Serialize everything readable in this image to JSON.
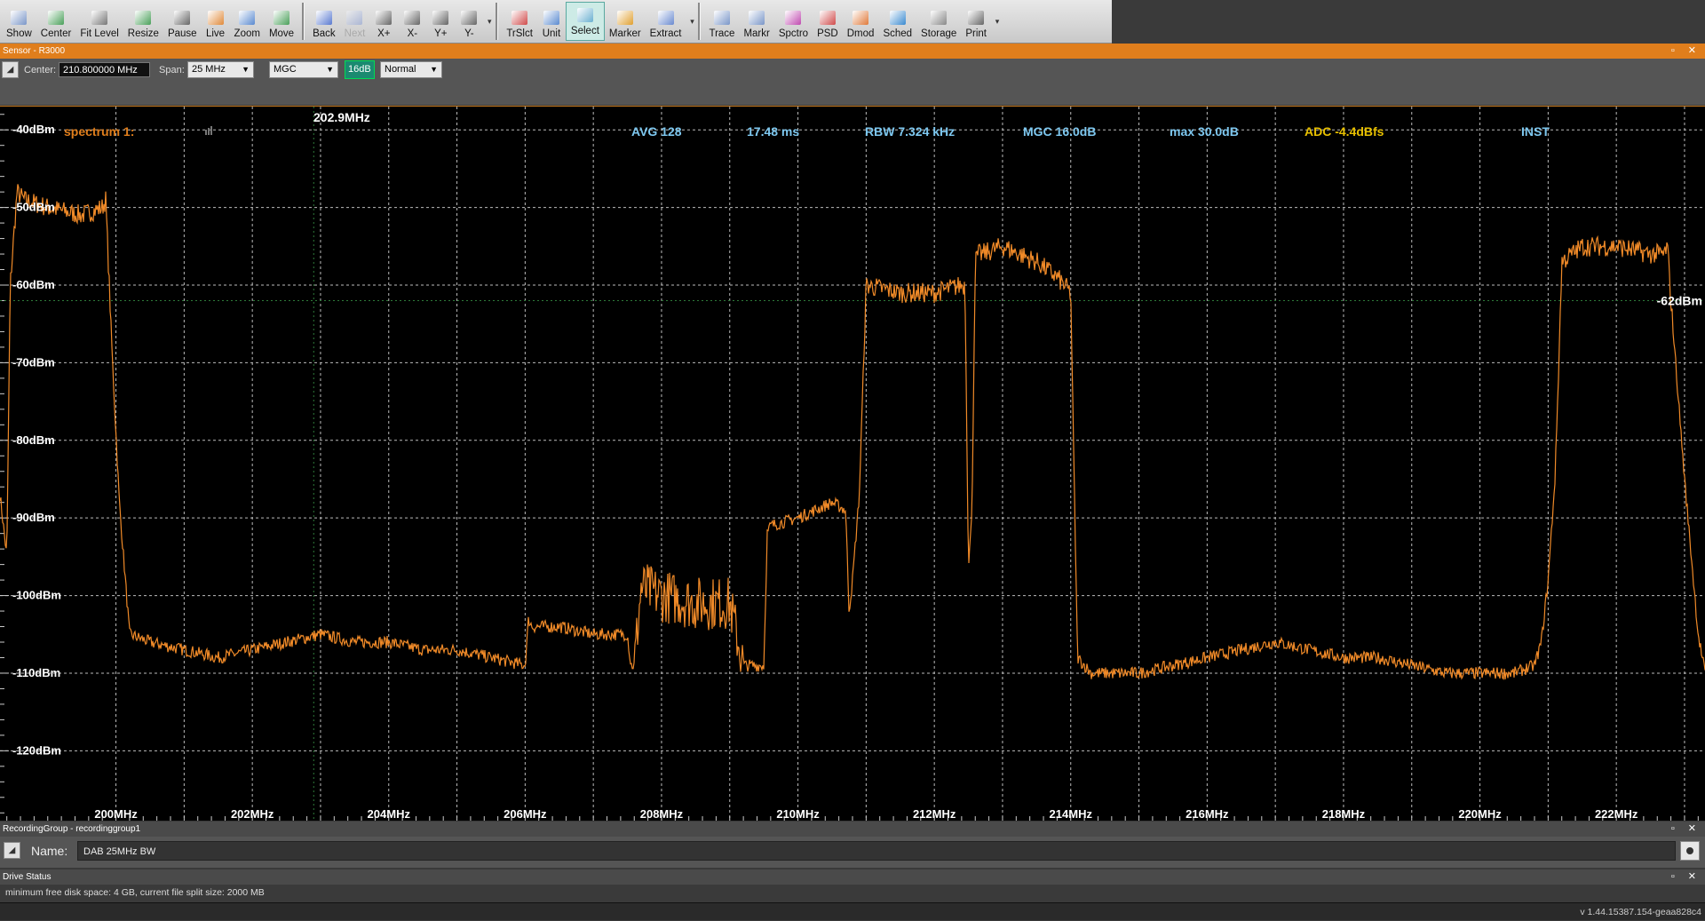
{
  "toolbar": {
    "groups": [
      [
        {
          "label": "Show",
          "icon": "show-icon",
          "color": "#7a96c8"
        },
        {
          "label": "Center",
          "icon": "center-icon",
          "color": "#4aa05a"
        },
        {
          "label": "Fit Level",
          "icon": "fit-level-icon",
          "color": "#777777"
        },
        {
          "label": "Resize",
          "icon": "resize-icon",
          "color": "#4aa05a"
        },
        {
          "label": "Pause",
          "icon": "pause-icon",
          "color": "#666666"
        },
        {
          "label": "Live",
          "icon": "live-icon",
          "color": "#e08a3a"
        },
        {
          "label": "Zoom",
          "icon": "zoom-icon",
          "color": "#5a8ad0"
        },
        {
          "label": "Move",
          "icon": "move-icon",
          "color": "#4aa05a"
        }
      ],
      [
        {
          "label": "Back",
          "icon": "back-icon",
          "color": "#5a7ad0"
        },
        {
          "label": "Next",
          "icon": "next-icon",
          "color": "#5a7ad0",
          "disabled": true
        },
        {
          "label": "X+",
          "icon": "x-plus-icon",
          "color": "#666666"
        },
        {
          "label": "X-",
          "icon": "x-minus-icon",
          "color": "#666666"
        },
        {
          "label": "Y+",
          "icon": "y-plus-icon",
          "color": "#666666"
        },
        {
          "label": "Y-",
          "icon": "y-minus-icon",
          "color": "#666666"
        }
      ],
      [
        {
          "label": "TrSlct",
          "icon": "trace-select-icon",
          "color": "#d04a4a"
        },
        {
          "label": "Unit",
          "icon": "unit-icon",
          "color": "#5a8ad0"
        },
        {
          "label": "Select",
          "icon": "select-icon",
          "color": "#6ab0d0",
          "active": true
        },
        {
          "label": "Marker",
          "icon": "marker-icon",
          "color": "#e0a030"
        },
        {
          "label": "Extract",
          "icon": "extract-icon",
          "color": "#6a8ad0"
        }
      ],
      [
        {
          "label": "Trace",
          "icon": "trace-icon",
          "color": "#7a96c8"
        },
        {
          "label": "Markr",
          "icon": "markr-icon",
          "color": "#7a96c8"
        },
        {
          "label": "Spctro",
          "icon": "spectro-icon",
          "color": "#c04ab0"
        },
        {
          "label": "PSD",
          "icon": "psd-icon",
          "color": "#d04a4a"
        },
        {
          "label": "Dmod",
          "icon": "dmod-icon",
          "color": "#e07a3a"
        },
        {
          "label": "Sched",
          "icon": "sched-icon",
          "color": "#3a8ad0"
        },
        {
          "label": "Storage",
          "icon": "storage-icon",
          "color": "#888888"
        },
        {
          "label": "Print",
          "icon": "print-icon",
          "color": "#666666"
        }
      ]
    ]
  },
  "sensor": {
    "title": "Sensor - R3000",
    "center_label": "Center:",
    "center_value": "210.800000  MHz",
    "span_label": "Span:",
    "span_value": "25 MHz",
    "gain_mode": "MGC",
    "gain_value": "16dB",
    "mode": "Normal"
  },
  "spectrum_info": {
    "label": "spectrum 1:",
    "avg": "AVG 128",
    "time": "17.48 ms",
    "rbw": "RBW 7.324 kHz",
    "mgc": "MGC 16.0dB",
    "max": "max 30.0dB",
    "adc": "ADC -4.4dBfs",
    "inst": "INST",
    "cursor_freq": "202.9MHz",
    "ref_level": "-62dBm"
  },
  "colors": {
    "trace": "#f08a28",
    "info_blue": "#7ec8f0",
    "info_yellow": "#e8c000",
    "accent_orange": "#e07e1c"
  },
  "chart_data": {
    "type": "line",
    "xlabel": "",
    "ylabel": "",
    "xlim": [
      198.3,
      223.3
    ],
    "ylim": [
      -129,
      -37
    ],
    "x_ticks": [
      "200MHz",
      "202MHz",
      "204MHz",
      "206MHz",
      "208MHz",
      "210MHz",
      "212MHz",
      "214MHz",
      "216MHz",
      "218MHz",
      "220MHz",
      "222MHz"
    ],
    "x_tick_values": [
      200,
      202,
      204,
      206,
      208,
      210,
      212,
      214,
      216,
      218,
      220,
      222
    ],
    "y_ticks": [
      "-40dBm",
      "-50dBm",
      "-60dBm",
      "-70dBm",
      "-80dBm",
      "-90dBm",
      "-100dBm",
      "-110dBm",
      "-120dBm"
    ],
    "y_tick_values": [
      -40,
      -50,
      -60,
      -70,
      -80,
      -90,
      -100,
      -110,
      -120
    ],
    "grid": true,
    "series": [
      {
        "x": [
          198.3,
          198.4,
          198.45,
          198.55,
          198.65,
          199.0,
          199.5,
          199.8,
          199.85,
          199.95,
          200.05,
          200.2,
          200.5,
          201.0,
          201.5,
          202.0,
          202.5,
          203.0,
          203.5,
          204.0,
          204.5,
          205.0,
          205.5,
          206.0,
          206.05,
          206.1,
          206.5,
          207.0,
          207.5,
          207.55,
          207.6,
          207.7,
          208.0,
          208.5,
          209.0,
          209.2,
          209.25,
          209.5,
          209.55,
          209.6,
          210.0,
          210.5,
          210.7,
          210.75,
          210.8,
          210.9,
          211.0,
          211.5,
          212.0,
          212.4,
          212.45,
          212.5,
          212.55,
          212.6,
          212.65,
          212.7,
          213.0,
          213.5,
          213.8,
          214.0,
          214.05,
          214.1,
          214.3,
          214.5,
          215.0,
          215.5,
          216.0,
          216.5,
          217.0,
          217.5,
          218.0,
          218.5,
          219.0,
          219.5,
          220.0,
          220.5,
          220.8,
          220.9,
          221.0,
          221.1,
          221.15,
          221.2,
          221.5,
          222.0,
          222.5,
          222.7,
          222.75,
          222.8,
          223.0,
          223.2,
          223.3
        ],
        "y": [
          -87,
          -95,
          -60,
          -48,
          -49,
          -50,
          -51,
          -50,
          -49,
          -70,
          -88,
          -105,
          -106,
          -107,
          -108,
          -107,
          -106,
          -105,
          -106,
          -106,
          -107,
          -107,
          -108,
          -109,
          -103,
          -104,
          -104,
          -105,
          -105,
          -109,
          -109,
          -99,
          -100,
          -101,
          -101,
          -109,
          -109,
          -109,
          -92,
          -91,
          -90,
          -88,
          -89,
          -102,
          -98,
          -87,
          -60,
          -61,
          -61,
          -60,
          -60,
          -96,
          -90,
          -57,
          -56,
          -56,
          -55,
          -57,
          -59,
          -61,
          -85,
          -108,
          -110,
          -110,
          -110,
          -109,
          -108,
          -107,
          -106,
          -107,
          -108,
          -108,
          -109,
          -110,
          -110,
          -110,
          -109,
          -106,
          -98,
          -85,
          -72,
          -57,
          -55,
          -55,
          -56,
          -56,
          -55,
          -62,
          -85,
          -105,
          -110
        ]
      }
    ]
  },
  "recording": {
    "title": "RecordingGroup - recordinggroup1",
    "name_label": "Name:",
    "name_value": "DAB 25MHz BW"
  },
  "drive": {
    "title": "Drive Status",
    "status_text": "minimum free disk space: 4 GB,  current file split size: 2000 MB"
  },
  "version": "v 1.44.15387.154-geaa828c4",
  "window_controls": "▫ ✕"
}
